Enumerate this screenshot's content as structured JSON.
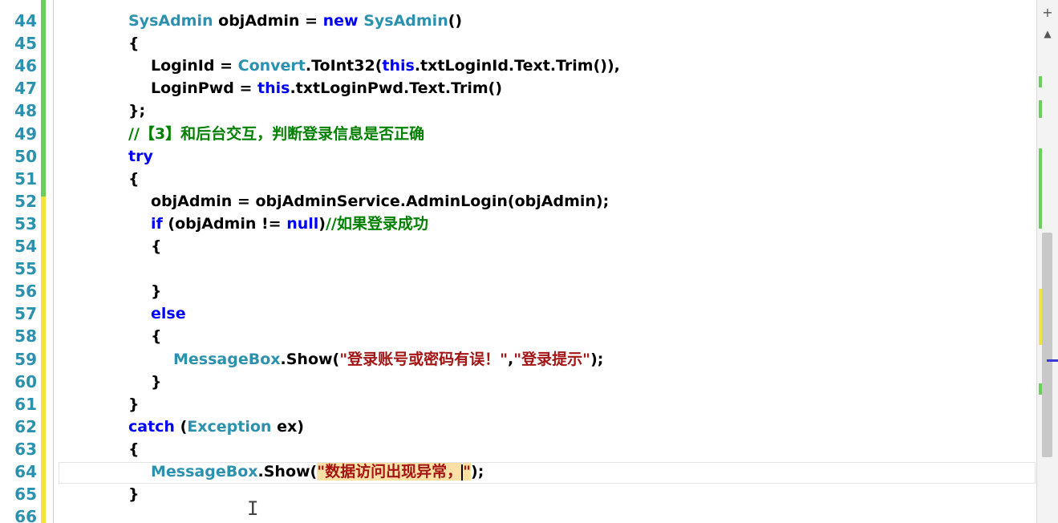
{
  "editor": {
    "lines": [
      {
        "num": "44",
        "indent": 0,
        "tokens": [
          {
            "t": "SysAdmin",
            "c": "ty"
          },
          {
            "t": " objAdmin = ",
            "c": ""
          },
          {
            "t": "new",
            "c": "kw"
          },
          {
            "t": " ",
            "c": ""
          },
          {
            "t": "SysAdmin",
            "c": "ty"
          },
          {
            "t": "()",
            "c": ""
          }
        ]
      },
      {
        "num": "45",
        "indent": 0,
        "tokens": [
          {
            "t": "{",
            "c": ""
          }
        ]
      },
      {
        "num": "46",
        "indent": 1,
        "tokens": [
          {
            "t": "LoginId = ",
            "c": ""
          },
          {
            "t": "Convert",
            "c": "ty"
          },
          {
            "t": ".ToInt32(",
            "c": ""
          },
          {
            "t": "this",
            "c": "kw"
          },
          {
            "t": ".txtLoginId.Text.Trim()),",
            "c": ""
          }
        ]
      },
      {
        "num": "47",
        "indent": 1,
        "tokens": [
          {
            "t": "LoginPwd = ",
            "c": ""
          },
          {
            "t": "this",
            "c": "kw"
          },
          {
            "t": ".txtLoginPwd.Text.Trim()",
            "c": ""
          }
        ]
      },
      {
        "num": "48",
        "indent": 0,
        "tokens": [
          {
            "t": "};",
            "c": ""
          }
        ]
      },
      {
        "num": "49",
        "indent": 0,
        "tokens": [
          {
            "t": "//【3】和后台交互，判断登录信息是否正确",
            "c": "cm"
          }
        ]
      },
      {
        "num": "50",
        "indent": 0,
        "tokens": [
          {
            "t": "try",
            "c": "kw"
          }
        ]
      },
      {
        "num": "51",
        "indent": 0,
        "tokens": [
          {
            "t": "{",
            "c": ""
          }
        ]
      },
      {
        "num": "52",
        "indent": 1,
        "tokens": [
          {
            "t": "objAdmin = objAdminService.AdminLogin(objAdmin);",
            "c": ""
          }
        ]
      },
      {
        "num": "53",
        "indent": 1,
        "tokens": [
          {
            "t": "if",
            "c": "kw"
          },
          {
            "t": " (objAdmin != ",
            "c": ""
          },
          {
            "t": "null",
            "c": "kw"
          },
          {
            "t": ")",
            "c": ""
          },
          {
            "t": "//如果登录成功",
            "c": "cm"
          }
        ]
      },
      {
        "num": "54",
        "indent": 1,
        "tokens": [
          {
            "t": "{",
            "c": ""
          }
        ]
      },
      {
        "num": "55",
        "indent": 1,
        "tokens": []
      },
      {
        "num": "56",
        "indent": 1,
        "tokens": [
          {
            "t": "}",
            "c": ""
          }
        ]
      },
      {
        "num": "57",
        "indent": 1,
        "tokens": [
          {
            "t": "else",
            "c": "kw"
          }
        ]
      },
      {
        "num": "58",
        "indent": 1,
        "tokens": [
          {
            "t": "{",
            "c": ""
          }
        ]
      },
      {
        "num": "59",
        "indent": 2,
        "tokens": [
          {
            "t": "MessageBox",
            "c": "ty"
          },
          {
            "t": ".Show(",
            "c": ""
          },
          {
            "t": "\"登录账号或密码有误！\"",
            "c": "str"
          },
          {
            "t": ",",
            "c": ""
          },
          {
            "t": "\"登录提示\"",
            "c": "str"
          },
          {
            "t": ");",
            "c": ""
          }
        ]
      },
      {
        "num": "60",
        "indent": 1,
        "tokens": [
          {
            "t": "}",
            "c": ""
          }
        ]
      },
      {
        "num": "61",
        "indent": 0,
        "tokens": [
          {
            "t": "}",
            "c": ""
          }
        ]
      },
      {
        "num": "62",
        "indent": 0,
        "tokens": [
          {
            "t": "catch",
            "c": "kw"
          },
          {
            "t": " (",
            "c": ""
          },
          {
            "t": "Exception",
            "c": "ty"
          },
          {
            "t": " ex)",
            "c": ""
          }
        ]
      },
      {
        "num": "63",
        "indent": 0,
        "tokens": [
          {
            "t": "{",
            "c": ""
          }
        ]
      },
      {
        "num": "64",
        "indent": 1,
        "tokens": [
          {
            "t": "MessageBox",
            "c": "ty"
          },
          {
            "t": ".Show(",
            "c": ""
          },
          {
            "t": "\"数据访问出现异常，",
            "c": "str hl"
          },
          {
            "t": "|",
            "c": "caret"
          },
          {
            "t": "\"",
            "c": "str hl"
          },
          {
            "t": ");",
            "c": ""
          }
        ]
      },
      {
        "num": "65",
        "indent": 0,
        "tokens": [
          {
            "t": "}",
            "c": ""
          }
        ]
      },
      {
        "num": "66",
        "indent": 0,
        "tokens": []
      }
    ]
  },
  "colors": {
    "keyword": "#0000ff",
    "type": "#2b91af",
    "string": "#a31515",
    "comment": "#008000",
    "line_number": "#2b91af",
    "change_saved": "#6bcf5c",
    "change_unsaved": "#f0e442"
  },
  "scrollbar": {
    "up_icon": "scroll-up-icon",
    "expand_icon": "plus-icon"
  }
}
